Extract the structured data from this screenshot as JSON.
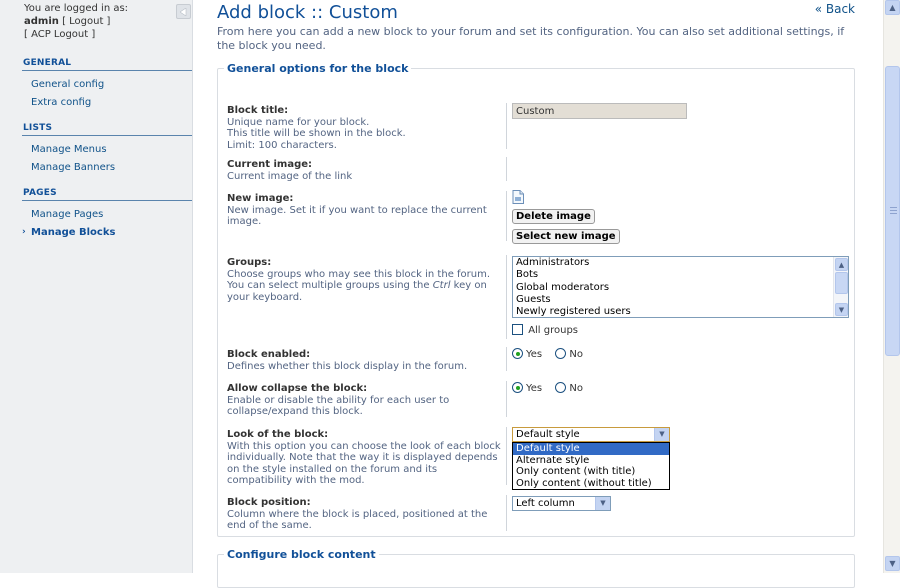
{
  "sidebar": {
    "logged_in_as": "You are logged in as:",
    "username": "admin",
    "logout": "[ Logout ]",
    "acp_logout": "[ ACP Logout ]",
    "sections": [
      {
        "title": "GENERAL",
        "items": [
          "General config",
          "Extra config"
        ]
      },
      {
        "title": "LISTS",
        "items": [
          "Manage Menus",
          "Manage Banners"
        ]
      },
      {
        "title": "PAGES",
        "items": [
          "Manage Pages",
          "Manage Blocks"
        ]
      }
    ],
    "active_item": "Manage Blocks"
  },
  "header": {
    "title": "Add block :: Custom",
    "back": "« Back",
    "intro": "From here you can add a new block to your forum and set its configuration. You can also set additional settings, if the block you need."
  },
  "general": {
    "legend": "General options for the block",
    "block_title": {
      "label": "Block title:",
      "explain": "Unique name for your block.\nThis title will be shown in the block.\nLimit: 100 characters.",
      "value": "Custom"
    },
    "current_image": {
      "label": "Current image:",
      "explain": "Current image of the link"
    },
    "new_image": {
      "label": "New image:",
      "explain": "New image. Set it if you want to replace the current image.",
      "delete_button": "Delete image",
      "select_button": "Select new image"
    },
    "groups": {
      "label": "Groups:",
      "explain_before": "Choose groups who may see this block in the forum. You can select multiple groups using the ",
      "explain_key": "Ctrl",
      "explain_after": " key on your keyboard.",
      "options": [
        "Administrators",
        "Bots",
        "Global moderators",
        "Guests",
        "Newly registered users"
      ],
      "all_groups": "All groups"
    },
    "block_enabled": {
      "label": "Block enabled:",
      "explain": "Defines whether this block display in the forum.",
      "yes": "Yes",
      "no": "No",
      "value": "Yes"
    },
    "allow_collapse": {
      "label": "Allow collapse the block:",
      "explain": "Enable or disable the ability for each user to collapse/expand this block.",
      "yes": "Yes",
      "no": "No",
      "value": "Yes"
    },
    "look": {
      "label": "Look of the block:",
      "explain": "With this option you can choose the look of each block individually. Note that the way it is displayed depends on the style installed on the forum and its compatibility with the mod.",
      "selected": "Default style",
      "options": [
        "Default style",
        "Alternate style",
        "Only content (with title)",
        "Only content (without title)"
      ]
    },
    "position": {
      "label": "Block position:",
      "explain": "Column where the block is placed, positioned at the end of the same.",
      "selected": "Left column"
    }
  },
  "content": {
    "legend": "Configure block content"
  }
}
